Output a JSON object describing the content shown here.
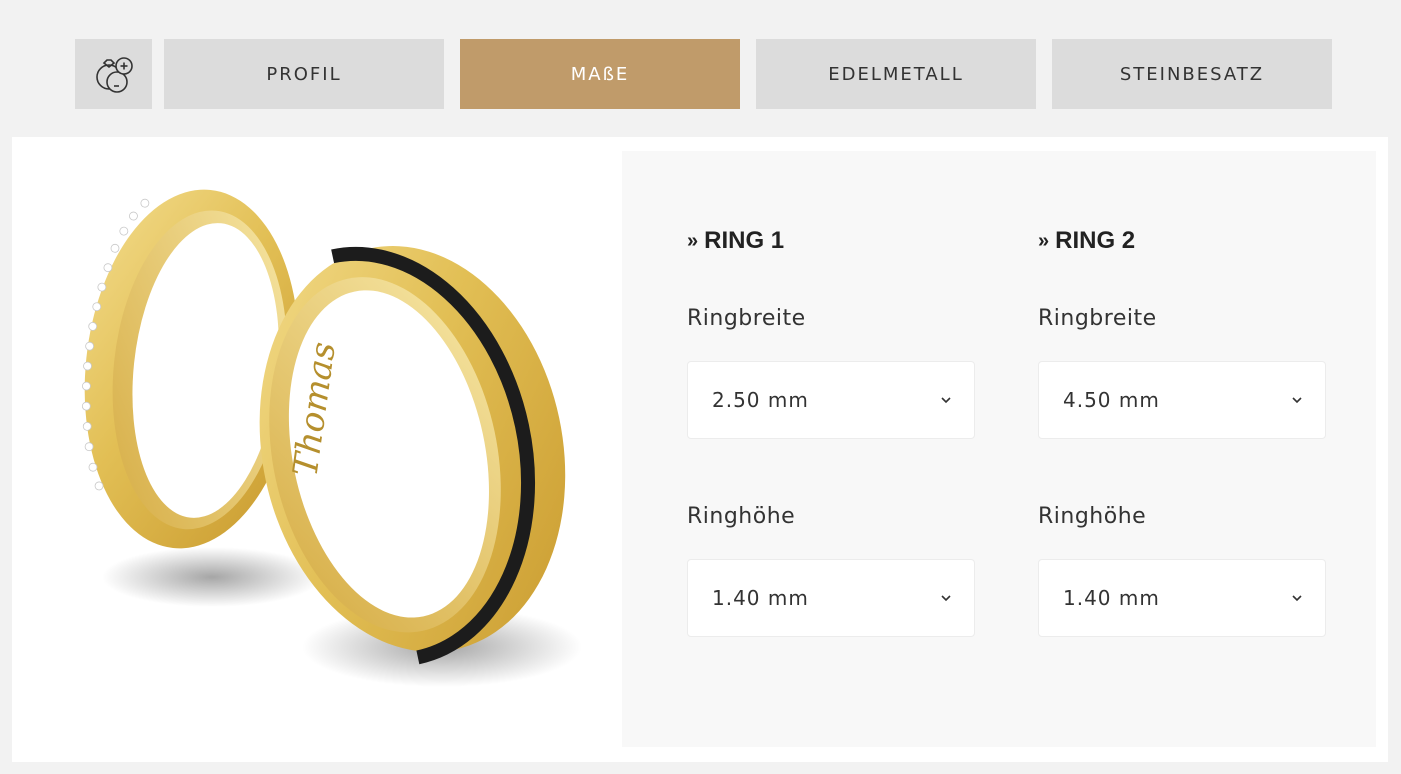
{
  "tabs": [
    {
      "label": "PROFIL",
      "active": false
    },
    {
      "label": "MAßE",
      "active": true
    },
    {
      "label": "EDELMETALL",
      "active": false
    },
    {
      "label": "STEINBESATZ",
      "active": false
    }
  ],
  "tab_icon": "ring-plus-minus-icon",
  "colors": {
    "accent": "#c09b6a",
    "tab_bg": "#dcdcdc",
    "panel_bg": "#f8f8f8"
  },
  "product_image": "wedding-rings-pair-image",
  "rings": [
    {
      "title": "RING 1",
      "width_label": "Ringbreite",
      "width_value": "2.50 mm",
      "height_label": "Ringhöhe",
      "height_value": "1.40 mm"
    },
    {
      "title": "RING 2",
      "width_label": "Ringbreite",
      "width_value": "4.50 mm",
      "height_label": "Ringhöhe",
      "height_value": "1.40 mm"
    }
  ]
}
